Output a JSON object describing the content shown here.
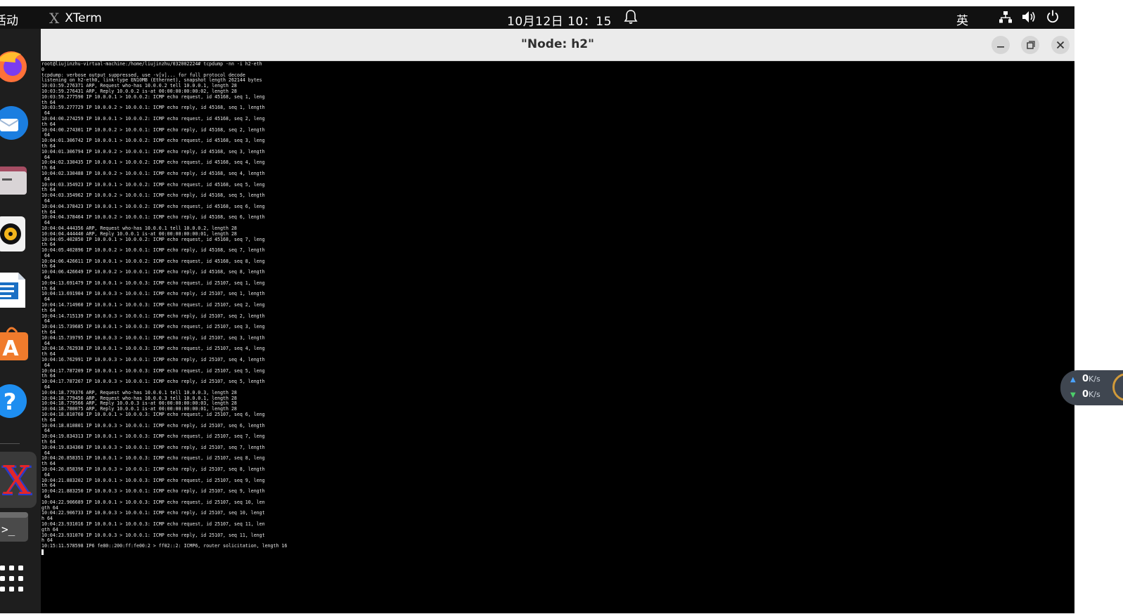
{
  "topbar": {
    "activities": "活动",
    "app_name": "XTerm",
    "clock": "10月12日  10：15",
    "ime": "英"
  },
  "window": {
    "title": "\"Node: h2\""
  },
  "netspeed": {
    "up_value": "0",
    "up_unit": "K/s",
    "down_value": "0",
    "down_unit": "K/s"
  },
  "colors": {
    "topbar_bg": "#111111",
    "dock_bg": "#1e1e1e",
    "titlebar_bg": "#ebebeb",
    "terminal_bg": "#000000"
  },
  "dock_icons": [
    "firefox-icon",
    "thunderbird-icon",
    "files-icon",
    "rhythmbox-icon",
    "libreoffice-writer-icon",
    "app-center-icon",
    "help-icon",
    "xterm-icon",
    "terminal-icon",
    "show-apps-icon"
  ],
  "terminal_lines": [
    "root@liujinzhu-virtual-machine:/home/liujinzhu/032002224# tcpdump -nn -i h2-eth",
    "0",
    "tcpdump: verbose output suppressed, use -v[v]... for full protocol decode",
    "listening on h2-eth0, link-type EN10MB (Ethernet), snapshot length 262144 bytes",
    "10:03:59.276371 ARP, Request who-has 10.0.0.2 tell 10.0.0.1, length 28",
    "10:03:59.276431 ARP, Reply 10.0.0.2 is-at 00:00:00:00:00:02, length 28",
    "10:03:59.277590 IP 10.0.0.1 > 10.0.0.2: ICMP echo request, id 45168, seq 1, leng",
    "th 64",
    "10:03:59.277729 IP 10.0.0.2 > 10.0.0.1: ICMP echo reply, id 45168, seq 1, length",
    " 64",
    "10:04:00.274259 IP 10.0.0.1 > 10.0.0.2: ICMP echo request, id 45168, seq 2, leng",
    "th 64",
    "10:04:00.274301 IP 10.0.0.2 > 10.0.0.1: ICMP echo reply, id 45168, seq 2, length",
    " 64",
    "10:04:01.306742 IP 10.0.0.1 > 10.0.0.2: ICMP echo request, id 45168, seq 3, leng",
    "th 64",
    "10:04:01.306794 IP 10.0.0.2 > 10.0.0.1: ICMP echo reply, id 45168, seq 3, length",
    " 64",
    "10:04:02.330435 IP 10.0.0.1 > 10.0.0.2: ICMP echo request, id 45168, seq 4, leng",
    "th 64",
    "10:04:02.330488 IP 10.0.0.2 > 10.0.0.1: ICMP echo reply, id 45168, seq 4, length",
    " 64",
    "10:04:03.354923 IP 10.0.0.1 > 10.0.0.2: ICMP echo request, id 45168, seq 5, leng",
    "th 64",
    "10:04:03.354962 IP 10.0.0.2 > 10.0.0.1: ICMP echo reply, id 45168, seq 5, length",
    " 64",
    "10:04:04.378423 IP 10.0.0.1 > 10.0.0.2: ICMP echo request, id 45168, seq 6, leng",
    "th 64",
    "10:04:04.378464 IP 10.0.0.2 > 10.0.0.1: ICMP echo reply, id 45168, seq 6, length",
    " 64",
    "10:04:04.444356 ARP, Request who-has 10.0.0.1 tell 10.0.0.2, length 28",
    "10:04:04.444440 ARP, Reply 10.0.0.1 is-at 00:00:00:00:00:01, length 28",
    "10:04:05.402850 IP 10.0.0.1 > 10.0.0.2: ICMP echo request, id 45168, seq 7, leng",
    "th 64",
    "10:04:05.402896 IP 10.0.0.2 > 10.0.0.1: ICMP echo reply, id 45168, seq 7, length",
    " 64",
    "10:04:06.426611 IP 10.0.0.1 > 10.0.0.2: ICMP echo request, id 45168, seq 8, leng",
    "th 64",
    "10:04:06.426649 IP 10.0.0.2 > 10.0.0.1: ICMP echo reply, id 45168, seq 8, length",
    " 64",
    "10:04:13.691479 IP 10.0.0.1 > 10.0.0.3: ICMP echo request, id 25107, seq 1, leng",
    "th 64",
    "10:04:13.691904 IP 10.0.0.3 > 10.0.0.1: ICMP echo reply, id 25107, seq 1, length",
    " 64",
    "10:04:14.714960 IP 10.0.0.1 > 10.0.0.3: ICMP echo request, id 25107, seq 2, leng",
    "th 64",
    "10:04:14.715139 IP 10.0.0.3 > 10.0.0.1: ICMP echo reply, id 25107, seq 2, length",
    " 64",
    "10:04:15.739685 IP 10.0.0.1 > 10.0.0.3: ICMP echo request, id 25107, seq 3, leng",
    "th 64",
    "10:04:15.739795 IP 10.0.0.3 > 10.0.0.1: ICMP echo reply, id 25107, seq 3, length",
    " 64",
    "10:04:16.762938 IP 10.0.0.1 > 10.0.0.3: ICMP echo request, id 25107, seq 4, leng",
    "th 64",
    "10:04:16.762991 IP 10.0.0.3 > 10.0.0.1: ICMP echo reply, id 25107, seq 4, length",
    " 64",
    "10:04:17.787209 IP 10.0.0.1 > 10.0.0.3: ICMP echo request, id 25107, seq 5, leng",
    "th 64",
    "10:04:17.787267 IP 10.0.0.3 > 10.0.0.1: ICMP echo reply, id 25107, seq 5, length",
    " 64",
    "10:04:18.779376 ARP, Request who-has 10.0.0.1 tell 10.0.0.3, length 28",
    "10:04:18.779456 ARP, Request who-has 10.0.0.3 tell 10.0.0.1, length 28",
    "10:04:18.779566 ARP, Reply 10.0.0.3 is-at 00:00:00:00:00:03, length 28",
    "10:04:18.780075 ARP, Reply 10.0.0.1 is-at 00:00:00:00:00:01, length 28",
    "10:04:18.810760 IP 10.0.0.1 > 10.0.0.3: ICMP echo request, id 25107, seq 6, leng",
    "th 64",
    "10:04:18.810801 IP 10.0.0.3 > 10.0.0.1: ICMP echo reply, id 25107, seq 6, length",
    " 64",
    "10:04:19.834313 IP 10.0.0.1 > 10.0.0.3: ICMP echo request, id 25107, seq 7, leng",
    "th 64",
    "10:04:19.834360 IP 10.0.0.3 > 10.0.0.1: ICMP echo reply, id 25107, seq 7, length",
    " 64",
    "10:04:20.858351 IP 10.0.0.1 > 10.0.0.3: ICMP echo request, id 25107, seq 8, leng",
    "th 64",
    "10:04:20.858396 IP 10.0.0.3 > 10.0.0.1: ICMP echo reply, id 25107, seq 8, length",
    " 64",
    "10:04:21.883202 IP 10.0.0.1 > 10.0.0.3: ICMP echo request, id 25107, seq 9, leng",
    "th 64",
    "10:04:21.883250 IP 10.0.0.3 > 10.0.0.1: ICMP echo reply, id 25107, seq 9, length",
    " 64",
    "10:04:22.906689 IP 10.0.0.1 > 10.0.0.3: ICMP echo request, id 25107, seq 10, len",
    "gth 64",
    "10:04:22.906733 IP 10.0.0.3 > 10.0.0.1: ICMP echo reply, id 25107, seq 10, lengt",
    "h 64",
    "10:04:23.931016 IP 10.0.0.1 > 10.0.0.3: ICMP echo request, id 25107, seq 11, len",
    "gth 64",
    "10:04:23.931070 IP 10.0.0.3 > 10.0.0.1: ICMP echo reply, id 25107, seq 11, lengt",
    "h 64",
    "10:15:11.578598 IP6 fe80::200:ff:fe00:2 > ff02::2: ICMP6, router solicitation, length 16"
  ]
}
